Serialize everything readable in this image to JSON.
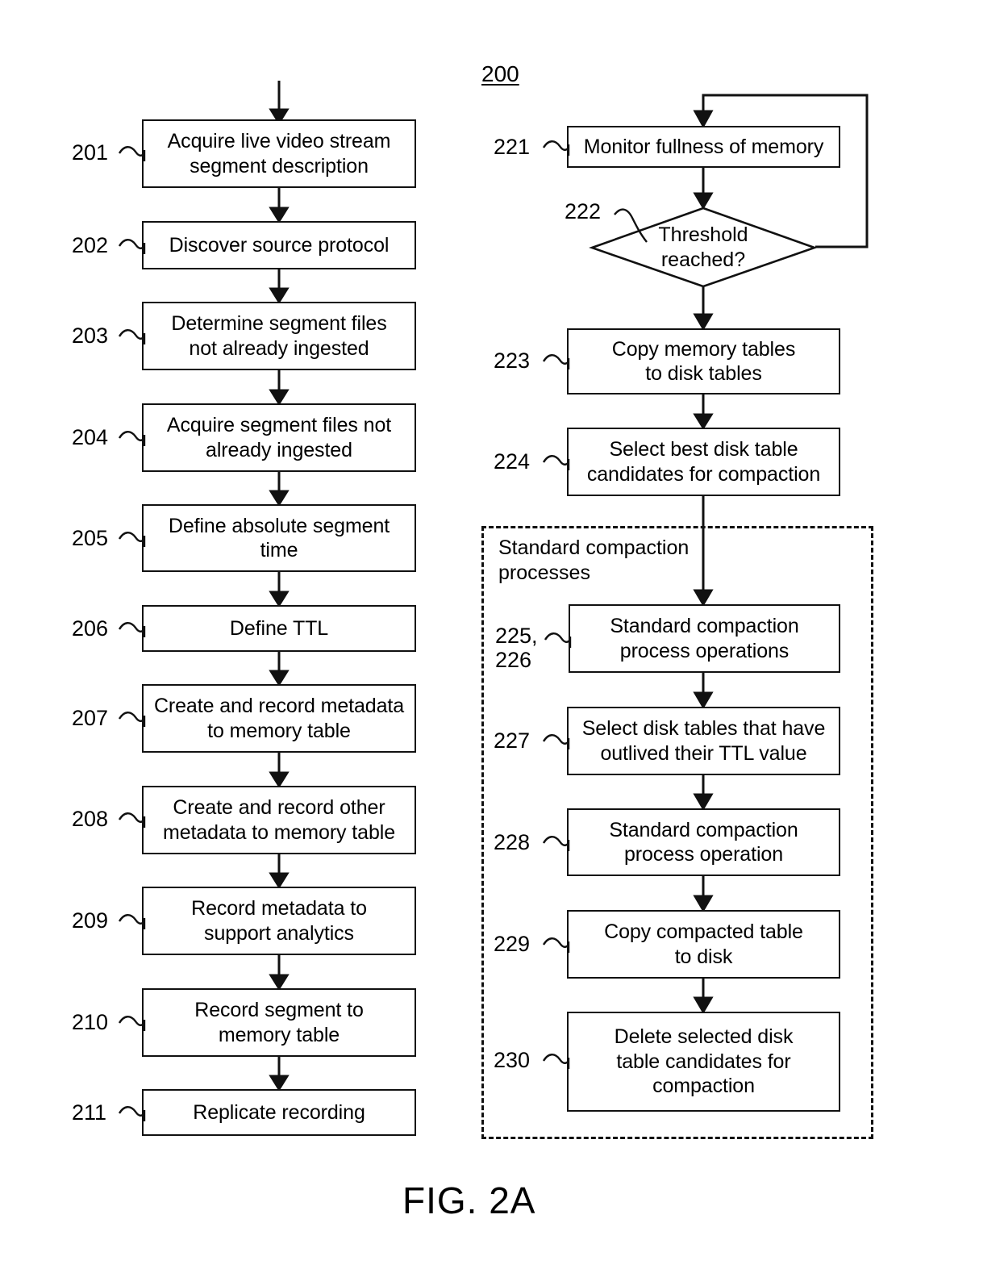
{
  "figure": {
    "caption": "FIG. 2A",
    "diagram_number": "200"
  },
  "left_column": {
    "nodes": [
      {
        "ref": "201",
        "text": "Acquire live video stream\nsegment description"
      },
      {
        "ref": "202",
        "text": "Discover source protocol"
      },
      {
        "ref": "203",
        "text": "Determine segment files\nnot already ingested"
      },
      {
        "ref": "204",
        "text": "Acquire segment files not\nalready ingested"
      },
      {
        "ref": "205",
        "text": "Define absolute segment\ntime"
      },
      {
        "ref": "206",
        "text": "Define TTL"
      },
      {
        "ref": "207",
        "text": "Create and record metadata\nto memory table"
      },
      {
        "ref": "208",
        "text": "Create and record other\nmetadata to memory table"
      },
      {
        "ref": "209",
        "text": "Record metadata to\nsupport analytics"
      },
      {
        "ref": "210",
        "text": "Record segment to\nmemory table"
      },
      {
        "ref": "211",
        "text": "Replicate recording"
      }
    ]
  },
  "right_column": {
    "nodes": [
      {
        "ref": "221",
        "text": "Monitor fullness of memory"
      },
      {
        "ref": "223",
        "text": "Copy memory tables\nto disk tables"
      },
      {
        "ref": "224",
        "text": "Select best disk table\ncandidates for compaction"
      }
    ],
    "decision": {
      "ref": "222",
      "text": "Threshold\nreached?"
    },
    "group": {
      "label": "Standard compaction\nprocesses",
      "nodes": [
        {
          "ref": "225,\n226",
          "text": "Standard compaction\nprocess operations"
        },
        {
          "ref": "227",
          "text": "Select disk tables that have\noutlived their TTL value"
        },
        {
          "ref": "228",
          "text": "Standard compaction\nprocess operation"
        },
        {
          "ref": "229",
          "text": "Copy compacted table\nto disk"
        },
        {
          "ref": "230",
          "text": "Delete selected disk\ntable candidates for\ncompaction"
        }
      ]
    }
  }
}
